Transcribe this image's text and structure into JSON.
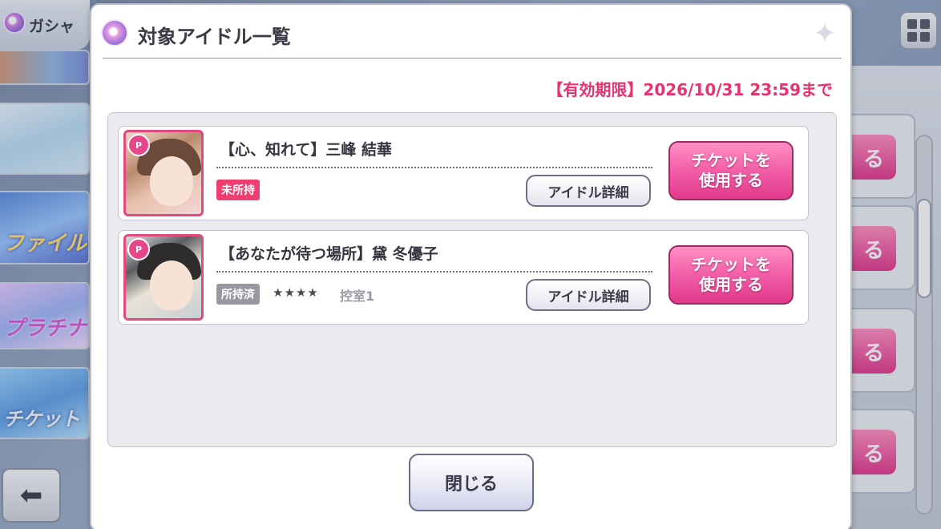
{
  "header": {
    "gacha_label": "ガシャ"
  },
  "side_banners": [
    {
      "text": ""
    },
    {
      "text": ""
    },
    {
      "text": "ファイル"
    },
    {
      "text": "プラチナ"
    },
    {
      "text": "チケット"
    }
  ],
  "right_panel": {
    "button_fragment": "る"
  },
  "dialog": {
    "title": "対象アイドル一覧",
    "expiry": "【有効期限】2026/10/31 23:59まで",
    "idols": [
      {
        "name": "【心、知れて】三峰 結華",
        "ownership": "未所持",
        "stars": "",
        "room": "",
        "detail_label": "アイドル詳細",
        "ticket_label": "チケットを\n使用する"
      },
      {
        "name": "【あなたが待つ場所】黛 冬優子",
        "ownership": "所持済",
        "stars": "★★★★",
        "room": "控室1",
        "detail_label": "アイドル詳細",
        "ticket_label": "チケットを\n使用する"
      }
    ],
    "close_label": "閉じる"
  },
  "icons": [
    "gacha-icon",
    "menu-grid-icon",
    "back-arrow-icon",
    "idol-list-icon",
    "sparkle-icon",
    "rarity-badge-icon"
  ],
  "colors": {
    "accent_pink": "#e13a8b",
    "expiry_red": "#e6336f",
    "not_owned_badge": "#ee3d6e",
    "owned_badge": "#9a97a1"
  }
}
